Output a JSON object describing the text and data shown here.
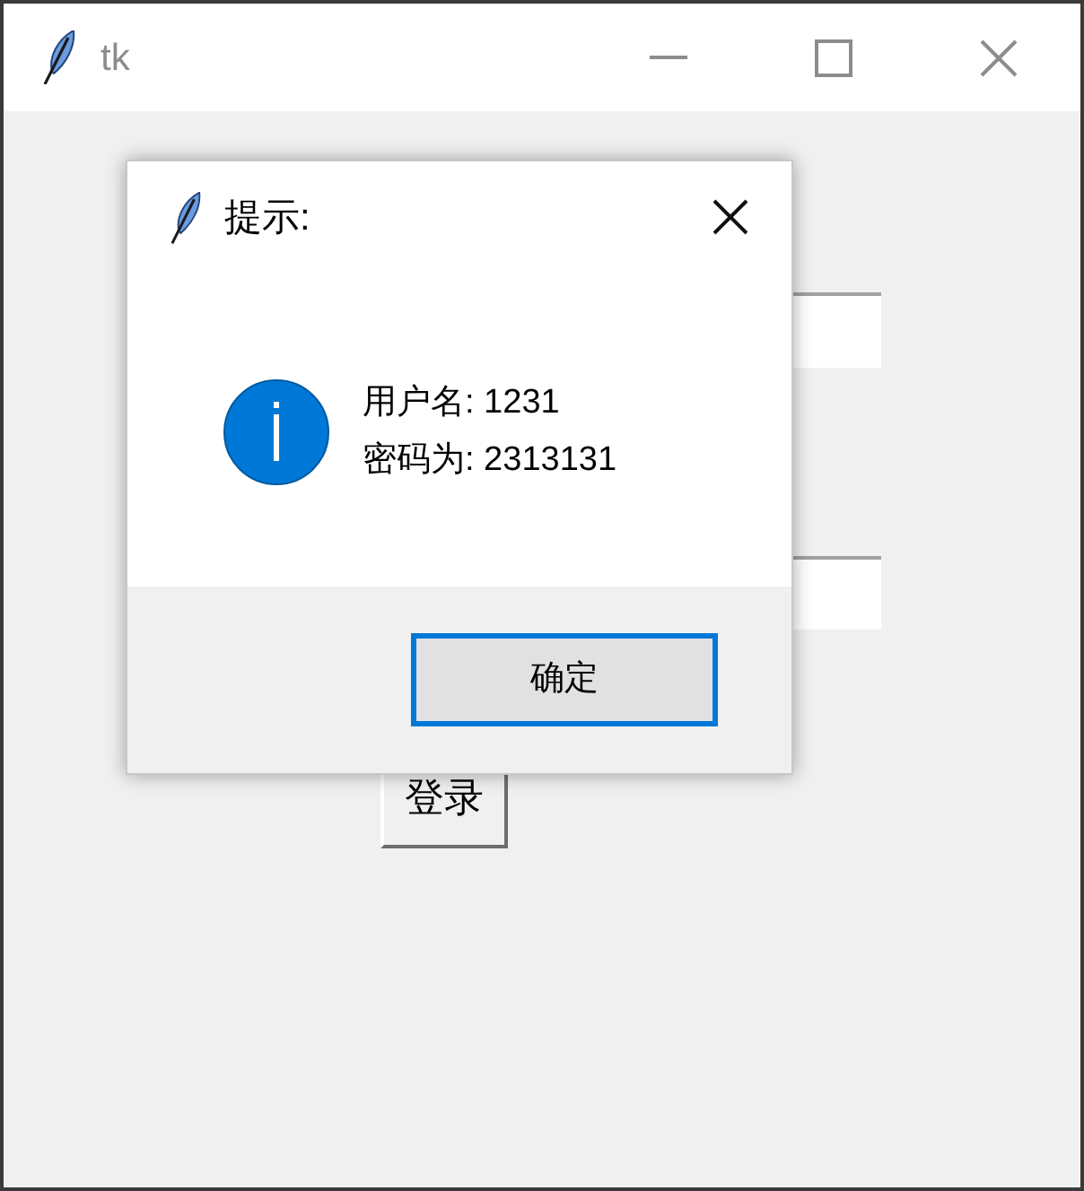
{
  "window": {
    "title": "tk"
  },
  "login_button": {
    "label": "登录"
  },
  "dialog": {
    "title": "提示:",
    "message_lines": [
      "用户名: 1231",
      "密码为: 2313131"
    ],
    "buttons": [
      {
        "label": "确定",
        "focused": true
      }
    ]
  }
}
